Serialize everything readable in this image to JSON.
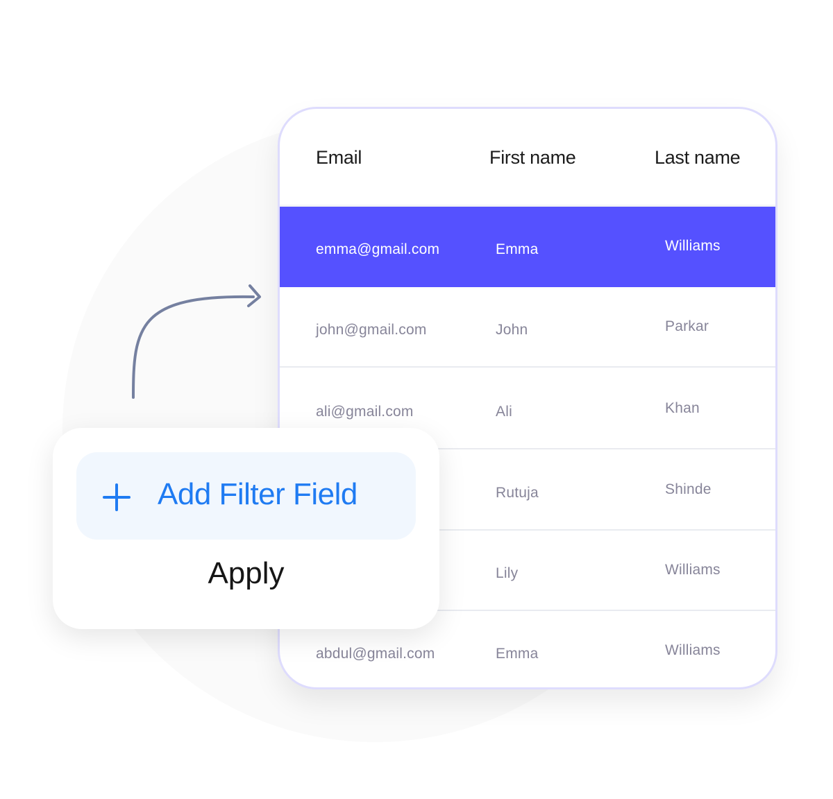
{
  "table": {
    "columns": [
      "Email",
      "First name",
      "Last name"
    ],
    "rows": [
      {
        "email": "emma@gmail.com",
        "first": "Emma",
        "last": "Williams",
        "selected": true
      },
      {
        "email": "john@gmail.com",
        "first": "John",
        "last": "Parkar",
        "selected": false
      },
      {
        "email": "ali@gmail.com",
        "first": "Ali",
        "last": "Khan",
        "selected": false
      },
      {
        "email": "",
        "first": "Rutuja",
        "last": "Shinde",
        "selected": false
      },
      {
        "email": "",
        "first": "Lily",
        "last": "Williams",
        "selected": false
      },
      {
        "email": "abdul@gmail.com",
        "first": "Emma",
        "last": "Williams",
        "selected": false
      }
    ]
  },
  "popup": {
    "add_filter_label": "Add Filter Field",
    "add_filter_icon": "plus-icon",
    "apply_label": "Apply"
  },
  "colors": {
    "accent": "#5551ff",
    "link_blue": "#1f7bf2",
    "arrow": "#7580a0",
    "card_border": "#dedcfd"
  }
}
